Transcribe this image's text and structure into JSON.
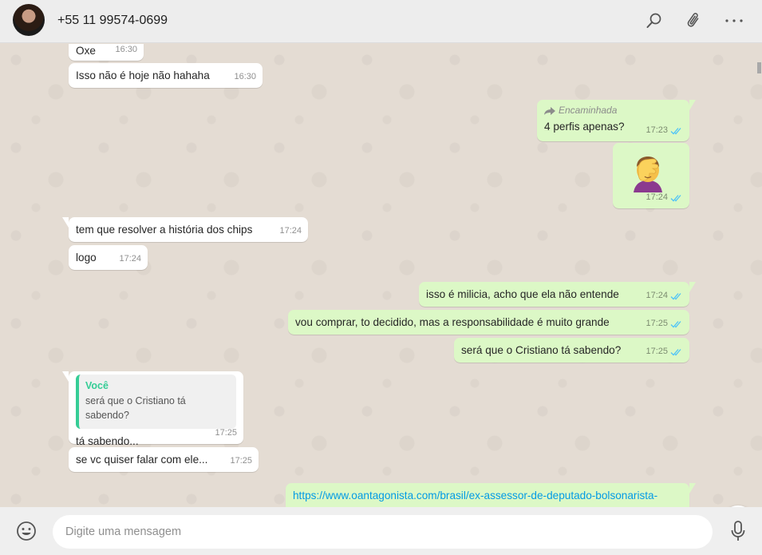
{
  "header": {
    "contact_name": "+55 11 99574-0699",
    "icons": [
      "search-icon",
      "attach-icon",
      "menu-icon"
    ]
  },
  "messages": [
    {
      "dir": "in",
      "text": "Oxe",
      "time": "16:30"
    },
    {
      "dir": "in",
      "text": "Isso não é hoje não hahaha",
      "time": "16:30"
    },
    {
      "dir": "out",
      "forwarded_label": "Encaminhada",
      "text": "4 perfis apenas?",
      "time": "17:23",
      "status": "read"
    },
    {
      "dir": "out",
      "emoji": "face-palm",
      "time": "17:24",
      "status": "read"
    },
    {
      "dir": "in",
      "text": "tem que resolver a história dos chips",
      "time": "17:24"
    },
    {
      "dir": "in",
      "text": "logo",
      "time": "17:24"
    },
    {
      "dir": "out",
      "text": "isso é milicia, acho que ela não entende",
      "time": "17:24",
      "status": "read"
    },
    {
      "dir": "out",
      "text": "vou comprar, to decidido, mas a responsabilidade é muito grande",
      "time": "17:25",
      "status": "read"
    },
    {
      "dir": "out",
      "text": "será que o Cristiano tá sabendo?",
      "time": "17:25",
      "status": "read"
    },
    {
      "dir": "in",
      "quote_author": "Você",
      "quote_text": "será que o Cristiano tá sabendo?",
      "text": "tá sabendo...",
      "time": "17:25"
    },
    {
      "dir": "in",
      "text": "se vc quiser falar com ele...",
      "time": "17:25"
    },
    {
      "dir": "out",
      "link": "https://www.oantagonista.com/brasil/ex-assessor-de-deputado-bolsonarista-"
    }
  ],
  "composer": {
    "placeholder": "Digite uma mensagem"
  },
  "colors": {
    "incoming_bubble": "#ffffff",
    "outgoing_bubble": "#dcf8c6",
    "read_ticks": "#4fc3f7",
    "quote_accent": "#35cd96",
    "link": "#039be5",
    "chat_background": "#e4dcd3"
  }
}
